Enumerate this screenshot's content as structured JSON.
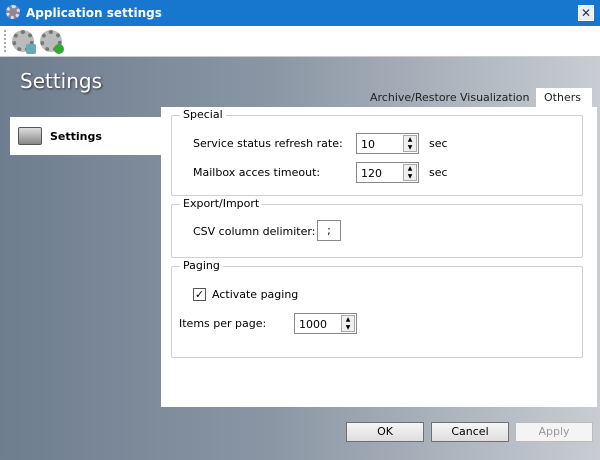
{
  "window": {
    "title": "Application settings",
    "close": "✕"
  },
  "toolbar": {
    "icons": [
      "settings-save-icon",
      "settings-add-icon"
    ]
  },
  "header": {
    "title": "Settings"
  },
  "nav": {
    "items": [
      {
        "label": "Settings"
      }
    ]
  },
  "tabs": [
    {
      "label": "Archive/Restore"
    },
    {
      "label": "Visualization"
    },
    {
      "label": "Others",
      "active": true
    }
  ],
  "special": {
    "title": "Special",
    "refresh_label": "Service status refresh rate:",
    "refresh_value": "10",
    "refresh_unit": "sec",
    "timeout_label": "Mailbox acces timeout:",
    "timeout_value": "120",
    "timeout_unit": "sec"
  },
  "export": {
    "title": "Export/Import",
    "delimiter_label": "CSV column delimiter:",
    "delimiter_value": ";"
  },
  "paging": {
    "title": "Paging",
    "activate_label": "Activate paging",
    "activate_checked": true,
    "check": "✓",
    "items_label": "Items per page:",
    "items_value": "1000"
  },
  "buttons": {
    "ok": "OK",
    "cancel": "Cancel",
    "apply": "Apply"
  }
}
